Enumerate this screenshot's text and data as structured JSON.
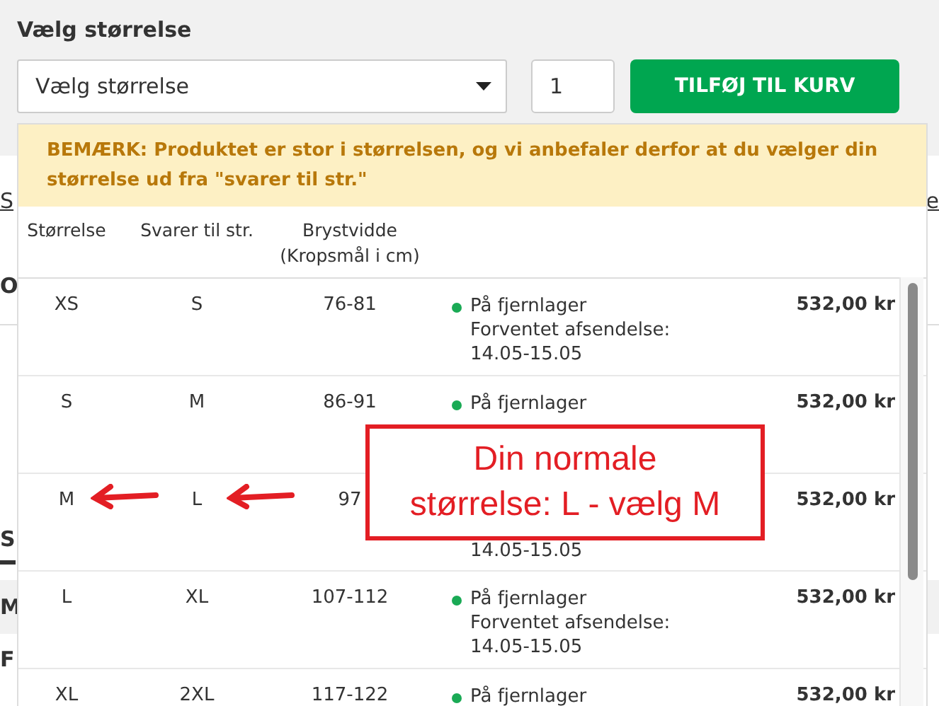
{
  "heading": "Vælg størrelse",
  "size_select": {
    "value": "Vælg størrelse"
  },
  "quantity": {
    "value": "1"
  },
  "add_button": "TILFØJ TIL KURV",
  "background_fragments": [
    "S",
    "e",
    "O",
    "S",
    "M",
    "F"
  ],
  "notice": "BEMÆRK: Produktet er stor i størrelsen, og vi anbefaler derfor at du vælger din størrelse ud fra \"svarer til str.\"",
  "columns": [
    "Størrelse",
    "Svarer til str.",
    "Brystvidde\n(Kropsmål i cm)"
  ],
  "rows": [
    {
      "size": "XS",
      "equivalent": "S",
      "chest": "76-81",
      "dot": true,
      "status_lines": [
        "På fjernlager",
        "Forventet afsendelse:",
        "14.05-15.05"
      ],
      "price": "532,00 kr"
    },
    {
      "size": "S",
      "equivalent": "M",
      "chest": "86-91",
      "dot": true,
      "status_lines": [
        "På fjernlager"
      ],
      "price": "532,00 kr"
    },
    {
      "size": "M",
      "equivalent": "L",
      "chest": "97",
      "dot": false,
      "status_lines": [
        "14.05-15.05"
      ],
      "price": "532,00 kr"
    },
    {
      "size": "L",
      "equivalent": "XL",
      "chest": "107-112",
      "dot": true,
      "status_lines": [
        "På fjernlager",
        "Forventet afsendelse:",
        "14.05-15.05"
      ],
      "price": "532,00 kr"
    },
    {
      "size": "XL",
      "equivalent": "2XL",
      "chest": "117-122",
      "dot": true,
      "status_lines": [
        "På fjernlager"
      ],
      "price": "532,00 kr"
    }
  ],
  "callout": {
    "lines": [
      "Din normale",
      "størrelse: L - vælg M"
    ]
  }
}
